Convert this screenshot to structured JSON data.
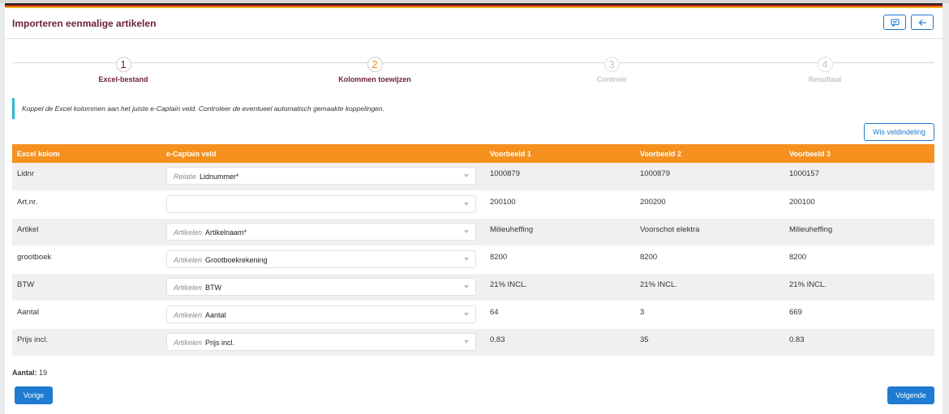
{
  "header": {
    "title": "Importeren eenmalige artikelen",
    "comment_icon": "comment-icon",
    "back_icon": "arrow-left-icon"
  },
  "steps": [
    {
      "number": "1",
      "label": "Excel-bestand",
      "state": "done"
    },
    {
      "number": "2",
      "label": "Kolommen toewijzen",
      "state": "active"
    },
    {
      "number": "3",
      "label": "Controle",
      "state": "future"
    },
    {
      "number": "4",
      "label": "Resultaat",
      "state": "future"
    }
  ],
  "info_text": "Koppel de Excel kolommen aan het juiste e-Captain veld. Controleer de eventueel automatisch gemaakte koppelingen.",
  "reset_label": "Wis veldindeling",
  "table": {
    "headers": [
      "Excel kolom",
      "e-Captain veld",
      "Voorbeeld 1",
      "Voorbeeld 2",
      "Voorbeeld 3"
    ],
    "rows": [
      {
        "excel": "Lidnr",
        "entity": "Relatie",
        "field": "Lidnummer*",
        "v1": "1000879",
        "v2": "1000879",
        "v3": "1000157"
      },
      {
        "excel": "Art.nr.",
        "entity": "",
        "field": "",
        "v1": "200100",
        "v2": "200200",
        "v3": "200100"
      },
      {
        "excel": "Artikel",
        "entity": "Artikelen",
        "field": "Artikelnaam*",
        "v1": "Milieuheffing",
        "v2": "Voorschot elektra",
        "v3": "Milieuheffing"
      },
      {
        "excel": "grootboek",
        "entity": "Artikelen",
        "field": "Grootboekrekening",
        "v1": "8200",
        "v2": "8200",
        "v3": "8200"
      },
      {
        "excel": "BTW",
        "entity": "Artikelen",
        "field": "BTW",
        "v1": "21% INCL.",
        "v2": "21% INCL.",
        "v3": "21% INCL."
      },
      {
        "excel": "Aantal",
        "entity": "Artikelen",
        "field": "Aantal",
        "v1": "64",
        "v2": "3",
        "v3": "669"
      },
      {
        "excel": "Prijs incl.",
        "entity": "Artikelen",
        "field": "Prijs incl.",
        "v1": "0.83",
        "v2": "35",
        "v3": "0.83"
      }
    ]
  },
  "count": {
    "label": "Aantal:",
    "value": "19"
  },
  "buttons": {
    "prev": "Vorige",
    "next": "Volgende"
  },
  "colors": {
    "brand": "#6b1f3f",
    "accent": "#f6901e",
    "primary": "#1f7bd1",
    "info": "#29b7d6"
  }
}
